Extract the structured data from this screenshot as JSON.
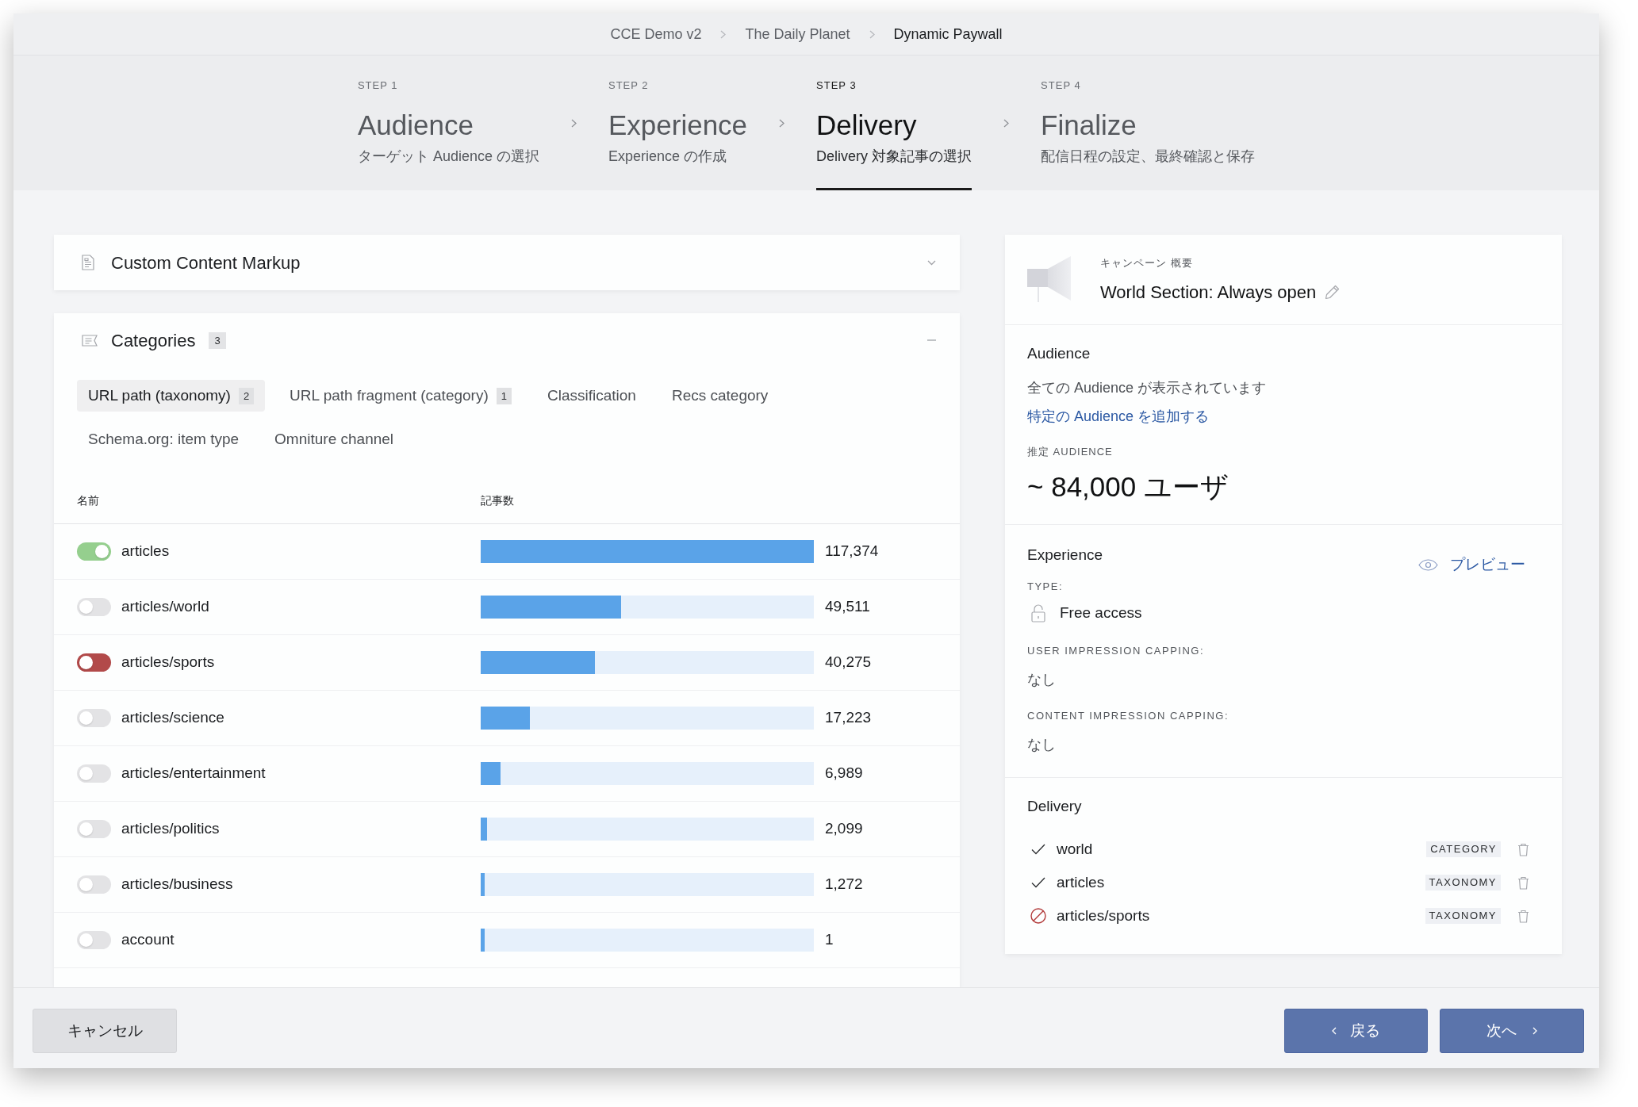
{
  "breadcrumb": [
    {
      "label": "CCE Demo v2",
      "current": false
    },
    {
      "label": "The Daily Planet",
      "current": false
    },
    {
      "label": "Dynamic Paywall",
      "current": true
    }
  ],
  "steps": [
    {
      "step": "STEP 1",
      "title": "Audience",
      "subtitle": "ターゲット Audience の選択",
      "selected": false
    },
    {
      "step": "STEP 2",
      "title": "Experience",
      "subtitle": "Experience の作成",
      "selected": false
    },
    {
      "step": "STEP 3",
      "title": "Delivery",
      "subtitle": "Delivery 対象記事の選択",
      "selected": true
    },
    {
      "step": "STEP 4",
      "title": "Finalize",
      "subtitle": "配信日程の設定、最終確認と保存",
      "selected": false
    }
  ],
  "custom_content_markup": {
    "title": "Custom Content Markup",
    "expanded": false
  },
  "categories": {
    "title": "Categories",
    "count": "3",
    "expanded": true,
    "tabs": [
      {
        "label": "URL path (taxonomy)",
        "count": "2",
        "selected": true
      },
      {
        "label": "URL path fragment (category)",
        "count": "1",
        "selected": false
      },
      {
        "label": "Classification",
        "selected": false
      },
      {
        "label": "Recs category",
        "selected": false
      },
      {
        "label": "Schema.org: item type",
        "selected": false
      },
      {
        "label": "Omniture channel",
        "selected": false
      }
    ],
    "table": {
      "columns": [
        "名前",
        "記事数"
      ],
      "rows": [
        {
          "name": "articles",
          "on": true,
          "color": "#95cf8e",
          "level": 1,
          "count": "117,374"
        },
        {
          "name": "articles/world",
          "on": false,
          "color": "#e3e3e5",
          "level": 0.422,
          "count": "49,511"
        },
        {
          "name": "articles/sports",
          "on": false,
          "color": "#b24a4a",
          "level": 0.343,
          "count": "40,275"
        },
        {
          "name": "articles/science",
          "on": false,
          "color": "#e3e3e5",
          "level": 0.147,
          "count": "17,223"
        },
        {
          "name": "articles/entertainment",
          "on": false,
          "color": "#e3e3e5",
          "level": 0.06,
          "count": "6,989"
        },
        {
          "name": "articles/politics",
          "on": false,
          "color": "#e3e3e5",
          "level": 0.018,
          "count": "2,099"
        },
        {
          "name": "articles/business",
          "on": false,
          "color": "#e3e3e5",
          "level": 0.012,
          "count": "1,272"
        },
        {
          "name": "account",
          "on": false,
          "color": "#e3e3e5",
          "level": 0.012,
          "count": "1"
        }
      ]
    }
  },
  "summary": {
    "label": "キャンペーン 概要",
    "title": "World Section: Always open",
    "audience": {
      "title": "Audience",
      "description": "全ての Audience が表示されています",
      "link": "特定の Audience を追加する",
      "estimate_label": "推定 AUDIENCE",
      "estimate": "~ 84,000 ユーザ"
    },
    "experience": {
      "title": "Experience",
      "preview": "プレビュー",
      "type_label": "TYPE:",
      "type": "Free access",
      "fields": [
        {
          "label": "USER IMPRESSION CAPPING:",
          "value": "なし"
        },
        {
          "label": "CONTENT IMPRESSION CAPPING:",
          "value": "なし"
        }
      ]
    },
    "delivery": {
      "title": "Delivery",
      "items": [
        {
          "label": "world",
          "kind": "included",
          "tag": "CATEGORY"
        },
        {
          "label": "articles",
          "kind": "included",
          "tag": "TAXONOMY"
        },
        {
          "label": "articles/sports",
          "kind": "excluded",
          "tag": "TAXONOMY"
        }
      ]
    }
  },
  "footer": {
    "cancel": "キャンセル",
    "back": "戻る",
    "next": "次へ"
  }
}
